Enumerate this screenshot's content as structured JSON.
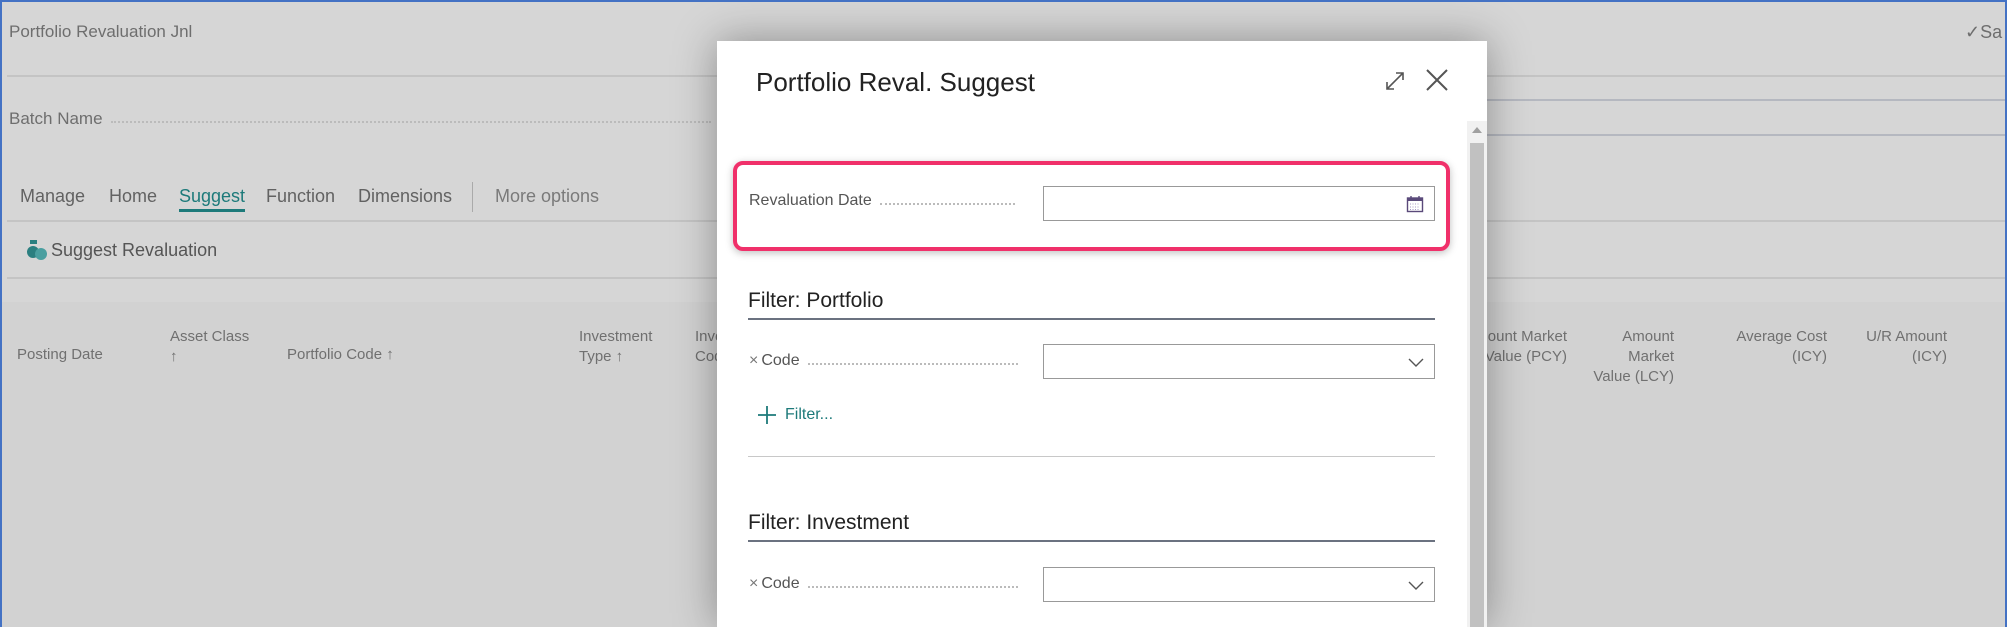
{
  "page": {
    "title": "Portfolio Revaluation Jnl",
    "save_status": "Sa",
    "batch_label": "Batch Name"
  },
  "tabs": [
    {
      "label": "Manage"
    },
    {
      "label": "Home"
    },
    {
      "label": "Suggest",
      "active": true
    },
    {
      "label": "Function"
    },
    {
      "label": "Dimensions"
    },
    {
      "label": "More options"
    }
  ],
  "actions": {
    "suggest_revaluation": "Suggest Revaluation"
  },
  "columns": [
    {
      "l1": "Posting Date",
      "l2": ""
    },
    {
      "l1": "Asset Class",
      "l2": "↑"
    },
    {
      "l1": "Portfolio Code ↑",
      "l2": ""
    },
    {
      "l1": "Investment",
      "l2": "Type ↑"
    },
    {
      "l1": "Inve",
      "l2": "Cod"
    },
    {
      "l1": "ount Market",
      "l2": "Value (PCY)"
    },
    {
      "l1": "Amount Market",
      "l2": "Value (LCY)"
    },
    {
      "l1": "Average Cost",
      "l2": "(ICY)"
    },
    {
      "l1": "U/R Amount",
      "l2": "(ICY)"
    }
  ],
  "dialog": {
    "title": "Portfolio Reval. Suggest",
    "revaluation_date_label": "Revaluation Date",
    "revaluation_date_value": "",
    "filter_portfolio": {
      "heading": "Filter: Portfolio",
      "code_label": "Code",
      "code_value": "",
      "add_filter": "Filter..."
    },
    "filter_investment": {
      "heading": "Filter: Investment",
      "code_label": "Code",
      "code_value": ""
    },
    "remove_glyph": "×"
  },
  "colors": {
    "accent": "#1d7a7a",
    "highlight": "#f0306a",
    "frame": "#4472c4"
  }
}
